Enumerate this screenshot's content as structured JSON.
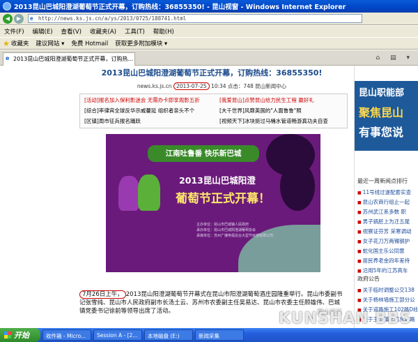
{
  "window": {
    "title": "2013昆山巴城阳澄湖葡萄节正式开幕，订购热线：36855350! - 昆山视窗 - Windows Internet Explorer",
    "address": "http://news.ks.js.cn/a/ys/2013/0725/188741.html"
  },
  "menu": [
    "文件(F)",
    "编辑(E)",
    "查看(V)",
    "收藏夹(A)",
    "工具(T)",
    "帮助(H)"
  ],
  "favorites": {
    "label": "收藏夹",
    "items": [
      "建议网站 ▾",
      "免费 Hotmail",
      "获取更多附加模块 ▾"
    ]
  },
  "tab": {
    "label": "2013昆山巴城阳澄湖葡萄节正式开幕，订购热..."
  },
  "article": {
    "title": "2013昆山巴城阳澄湖葡萄节正式开幕，订购热线：36855350!",
    "meta_source": "news.ks.js.cn",
    "meta_date": "2013-07-25",
    "meta_rest": "10:34 点击：748 昆山新闻中心",
    "links": [
      {
        "a": "[活动]报名加入保利影迷会 无需办卡即享观影五折",
        "b": "[我爱昆山]点赞昆山给力民生工程 赢好礼"
      },
      {
        "a": "[综合]率律宾全球反华示威蔓延 组织者亲头不个",
        "b": "[大千世界]风靡英国的\"人面鲁鲁\"照"
      },
      {
        "a": "[区镇]周市征兵报名踊跃",
        "b": "[视频天下]冰块挺过马桶水管道畅游真功夫自查"
      }
    ],
    "poster": {
      "top_banner": "江南吐鲁番 快乐新巴城",
      "subtitle": "2013昆山巴城阳澄",
      "main": "葡萄节正式开幕！",
      "lines": [
        "主办单位：昆山市巴城镇人民政府",
        "承办单位：昆山市巴城阳澄湖葡萄协会",
        "承接单位：苏州广播电视总台大型节目部有限公司"
      ]
    },
    "para_date": "7月26日上午，",
    "para_text": "2013昆山阳澄湖葡萄节开幕式在昆山市阳澄湖葡萄酒庄园隆重举行。昆山市委副书记张雪纯、昆山市人民政府副市长汤土云、苏州市农委副主任吴易达、昆山市农委主任顾雄伟、巴城镇党委书记徐前等领导出席了活动。"
  },
  "sidebar": {
    "banner": [
      "昆山职能部",
      "聚焦昆山",
      "有事您说"
    ],
    "news_head": "最近一周新闻点排行",
    "news": [
      "11号线过遂配套实查",
      "昆山农商行组止一起",
      "苏州武江系多数 职",
      "男子搞胚上为迁五尾",
      "视察证芬芳 采寒调动",
      "女子花刀万两镯钢护",
      "蛇化国主乐公同意",
      "居民养老金四年差持",
      "沿用5年的江苏高车"
    ],
    "gov_head": "政府公告",
    "gov": [
      "关于临时调整公交138",
      "关于杨林墙施工部分公",
      "关于道路施工102路D线",
      "关于玉山镇北汽车站路"
    ]
  },
  "taskbar": {
    "start": "开始",
    "buttons": [
      "收件箱 - Micro...",
      "Session A - [2...",
      "本地磁盘 (E:)",
      "新闻采集"
    ]
  },
  "watermark": {
    "top": "昆山论坛",
    "main": "KUNSHAN BBS"
  }
}
